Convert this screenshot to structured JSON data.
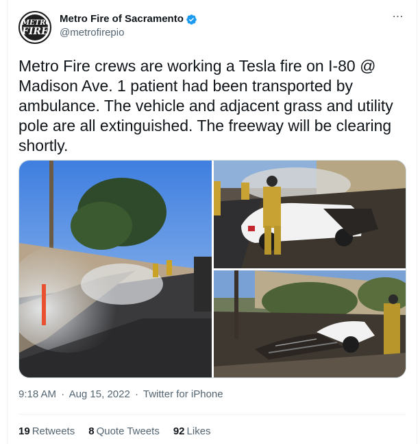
{
  "author": {
    "display_name": "Metro Fire of Sacramento",
    "handle": "@metrofirepio",
    "avatar_text_line1": "METRO",
    "avatar_text_line2": "FIRE"
  },
  "more_icon": "⋯",
  "tweet": {
    "text": "Metro Fire crews are working a Tesla fire on I-80 @ Madison Ave. 1 patient had been transported by ambulance. The vehicle and adjacent grass and utility pole are all extinguished. The freeway will be clearing shortly."
  },
  "meta": {
    "time": "9:18 AM",
    "dot1": "·",
    "date": "Aug 15, 2022",
    "dot2": "·",
    "source": "Twitter for iPhone"
  },
  "stats": {
    "retweets_count": "19",
    "retweets_label": "Retweets",
    "quotes_count": "8",
    "quotes_label": "Quote Tweets",
    "likes_count": "92",
    "likes_label": "Likes"
  },
  "colors": {
    "text": "#0f1419",
    "secondary": "#536471",
    "verified": "#1d9bf0",
    "border": "#eff3f4"
  }
}
